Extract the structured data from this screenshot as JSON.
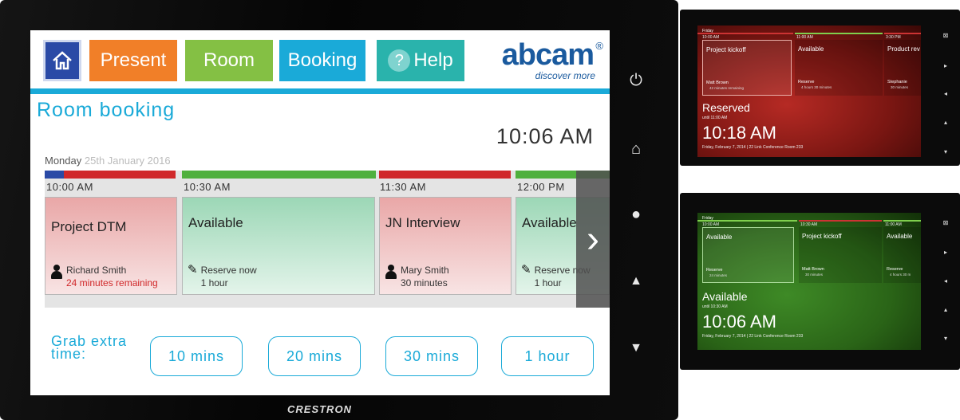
{
  "main": {
    "tabs": {
      "present": "Present",
      "room": "Room",
      "booking": "Booking",
      "help": "Help",
      "help_glyph": "?"
    },
    "brand": {
      "name": "abcam",
      "reg": "®",
      "tagline": "discover more"
    },
    "page_title": "Room booking",
    "clock": "10:06 AM",
    "date": {
      "day": "Monday",
      "rest": "25th January 2016"
    },
    "timeline": {
      "times": [
        "10:00 AM",
        "10:30 AM",
        "11:30 AM",
        "12:00 PM"
      ],
      "cards": [
        {
          "title": "Project DTM",
          "line1": "Richard Smith",
          "line2": "24 minutes remaining",
          "status": "reserved"
        },
        {
          "title": "Available",
          "line1": "Reserve now",
          "line2": "1 hour",
          "status": "available"
        },
        {
          "title": "JN Interview",
          "line1": "Mary Smith",
          "line2": "30 minutes",
          "status": "reserved"
        },
        {
          "title": "Available",
          "line1": "Reserve now",
          "line2": "1 hour",
          "status": "available"
        }
      ],
      "next_glyph": "›"
    },
    "grab_extra": {
      "label_line1": "Grab extra",
      "label_line2": "time:",
      "options": [
        "10 mins",
        "20 mins",
        "30 mins",
        "1 hour"
      ]
    },
    "hardware_logo": "CRESTRON"
  },
  "panel_red": {
    "day": "Friday",
    "times": [
      "10:00 AM",
      "11:00 AM",
      "3:30 PM"
    ],
    "slots": [
      {
        "title": "Project kickoff",
        "line1": "Matt Brown",
        "line2": "42 minutes remaining"
      },
      {
        "title": "Available",
        "line1": "Reserve",
        "line2": "4 hours 30 minutes"
      },
      {
        "title": "Product rev",
        "line1": "Stephanie",
        "line2": "30 minutes"
      }
    ],
    "status": "Reserved",
    "until": "until 11:00 AM",
    "clock": "10:18 AM",
    "info": "Friday, February 7, 2014  |  22 Link Conference Room 233"
  },
  "panel_green": {
    "day": "Friday",
    "times": [
      "10:00 AM",
      "10:30 AM",
      "11:00 AM"
    ],
    "slots": [
      {
        "title": "Available",
        "line1": "Reserve",
        "line2": "24 minutes"
      },
      {
        "title": "Project kickoff",
        "line1": "Matt Brown",
        "line2": "30 minutes"
      },
      {
        "title": "Available",
        "line1": "Reserve",
        "line2": "4 hours 30 m"
      }
    ],
    "status": "Available",
    "until": "until 10:30 AM",
    "clock": "10:06 AM",
    "info": "Friday, February 7, 2014  |  22 Link Conference Room 233"
  },
  "colors": {
    "accent": "#1aaad8",
    "reserved": "#d0282a",
    "available": "#84c044",
    "present": "#f17f28",
    "help": "#2ab3ac",
    "home": "#2a4aa6"
  }
}
